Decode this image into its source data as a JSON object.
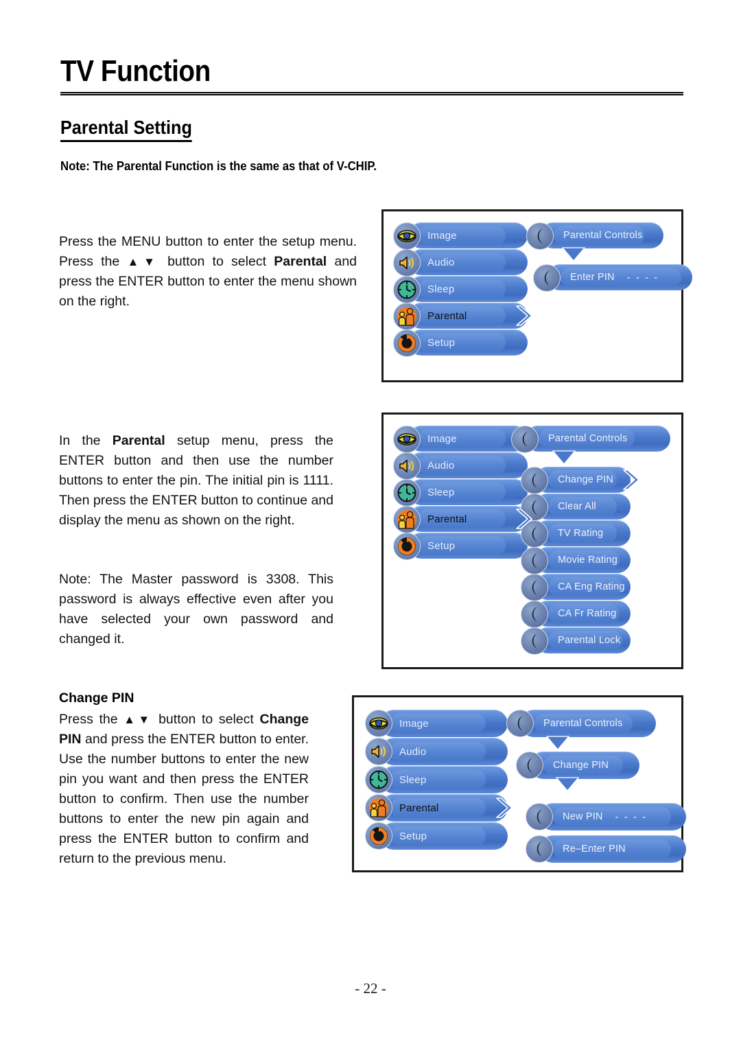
{
  "page": {
    "title": "TV Function",
    "section": "Parental Setting",
    "note": "Note: The Parental Function is the same as that of V-CHIP.",
    "footer": "- 22 -"
  },
  "paragraphs": {
    "p1_a": "Press the MENU button to enter the setup menu. Press the ",
    "p1_arrows": "▲▼",
    "p1_b": " button to select ",
    "p1_bold": "Parental",
    "p1_c": " and press the ENTER button to enter the menu shown on the right.",
    "p2_a": "In the ",
    "p2_bold": "Parental",
    "p2_b": " setup menu, press the ENTER button and then use the number buttons to enter the pin. The initial pin is 1111. Then press the ENTER button to continue and display the menu as shown on the right.",
    "p3": "Note: The Master password is 3308. This password is always effective even after you have selected your own password and changed it.",
    "change_pin_heading": "Change PIN",
    "p4_a": "Press the ",
    "p4_arrows": "▲▼",
    "p4_b": " button to select ",
    "p4_bold": "Change PIN",
    "p4_c": " and press the ENTER button to enter. Use the number buttons to enter the new pin you want and then press the ENTER button to confirm. Then use the number buttons to enter the new pin again and press the ENTER button to confirm and return to the previous menu."
  },
  "osd": {
    "main_menu": [
      {
        "label": "Image",
        "icon": "eye-icon",
        "selected": false
      },
      {
        "label": "Audio",
        "icon": "speaker-icon",
        "selected": false
      },
      {
        "label": "Sleep",
        "icon": "clock-icon",
        "selected": false
      },
      {
        "label": "Parental",
        "icon": "parental-icon",
        "selected": true
      },
      {
        "label": "Setup",
        "icon": "refresh-icon",
        "selected": false
      }
    ],
    "figure1": {
      "header": "Parental Controls",
      "items": [
        {
          "label": "Enter PIN",
          "value": "- - - -",
          "icon": "moon-icon"
        }
      ]
    },
    "figure2": {
      "header": "Parental Controls",
      "items": [
        {
          "label": "Change PIN",
          "icon": "moon-icon",
          "selected": true
        },
        {
          "label": "Clear All",
          "icon": "moon-icon",
          "selected": false
        },
        {
          "label": "TV Rating",
          "icon": "moon-icon",
          "selected": false
        },
        {
          "label": "Movie Rating",
          "icon": "moon-icon",
          "selected": false
        },
        {
          "label": "CA Eng Rating",
          "icon": "moon-icon",
          "selected": false
        },
        {
          "label": "CA Fr Rating",
          "icon": "moon-icon",
          "selected": false
        },
        {
          "label": "Parental Lock",
          "icon": "moon-icon",
          "selected": false
        }
      ]
    },
    "figure3": {
      "header": "Parental Controls",
      "sub_header": "Change PIN",
      "items": [
        {
          "label": "New PIN",
          "value": "- - - -",
          "icon": "moon-icon"
        },
        {
          "label": "Re–Enter PIN",
          "value": "",
          "icon": "moon-icon"
        }
      ]
    }
  },
  "colors": {
    "pill_blue": "#4a79cc",
    "pill_blue_light": "#6f9be0",
    "icon_eye": "#f2e23a",
    "icon_speaker": "#f5a623",
    "icon_clock": "#3fb89a",
    "icon_parental": "#f07d20",
    "icon_setup": "#f07d20",
    "text_light": "#e8eef9",
    "text_selected": "#101010",
    "border": "#1a1a1a"
  }
}
